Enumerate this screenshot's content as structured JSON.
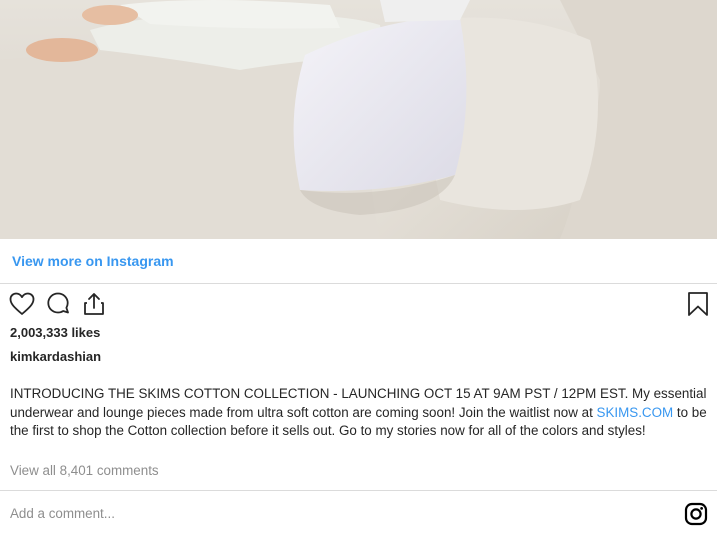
{
  "post": {
    "image_alt": "Woman in light lounge wear lying on a beige sofa with white pillows",
    "view_more_label": "View more on Instagram",
    "likes": "2,003,333 likes",
    "username": "kimkardashian",
    "caption_part1": "INTRODUCING THE SKIMS COTTON COLLECTION - LAUNCHING OCT 15 AT 9AM PST / 12PM EST. My essential underwear and lounge pieces made from ultra soft cotton are coming soon! Join the waitlist now at ",
    "caption_link": "SKIMS.COM",
    "caption_part2": " to be the first to shop the Cotton collection before it sells out. Go to my stories now for all of the colors and styles!",
    "view_comments_label": "View all 8,401 comments",
    "add_comment_placeholder": "Add a comment..."
  },
  "icons": {
    "like": "heart-icon",
    "comment": "comment-bubble-icon",
    "share": "share-icon",
    "save": "bookmark-icon",
    "brand": "instagram-logo-icon"
  },
  "colors": {
    "link": "#3897f0",
    "text": "#262626",
    "muted": "#8e8e8e",
    "divider": "#dbdbdb"
  }
}
